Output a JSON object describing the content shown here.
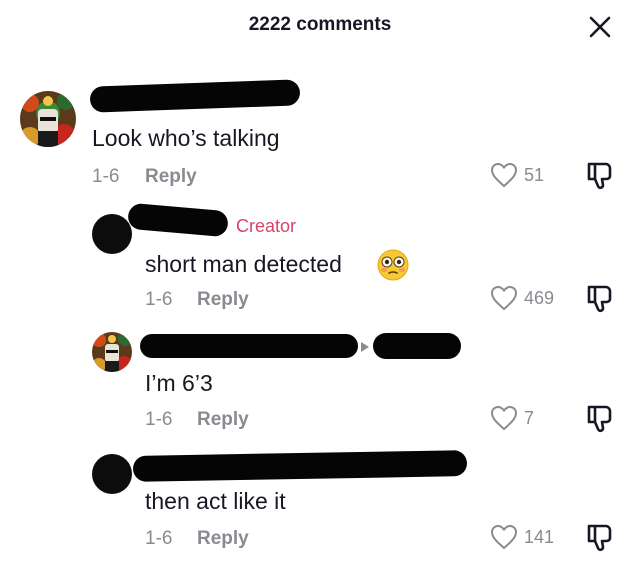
{
  "header": {
    "title": "2222 comments"
  },
  "icons": {
    "close": "close-icon",
    "like": "heart-outline-icon",
    "dislike": "thumbs-down-icon",
    "emoji": "flushed-face-emoji"
  },
  "colors": {
    "creator": "#d8436a",
    "meta": "#8a8b91",
    "text": "#161823"
  },
  "comments": [
    {
      "text": "Look who’s talking",
      "date": "1-6",
      "reply": "Reply",
      "likes": "51"
    },
    {
      "badge": "Creator",
      "text": "short man detected",
      "date": "1-6",
      "reply": "Reply",
      "likes": "469"
    },
    {
      "text": "I’m 6’3",
      "date": "1-6",
      "reply": "Reply",
      "likes": "7"
    },
    {
      "text": "then act like it",
      "date": "1-6",
      "reply": "Reply",
      "likes": "141"
    }
  ]
}
